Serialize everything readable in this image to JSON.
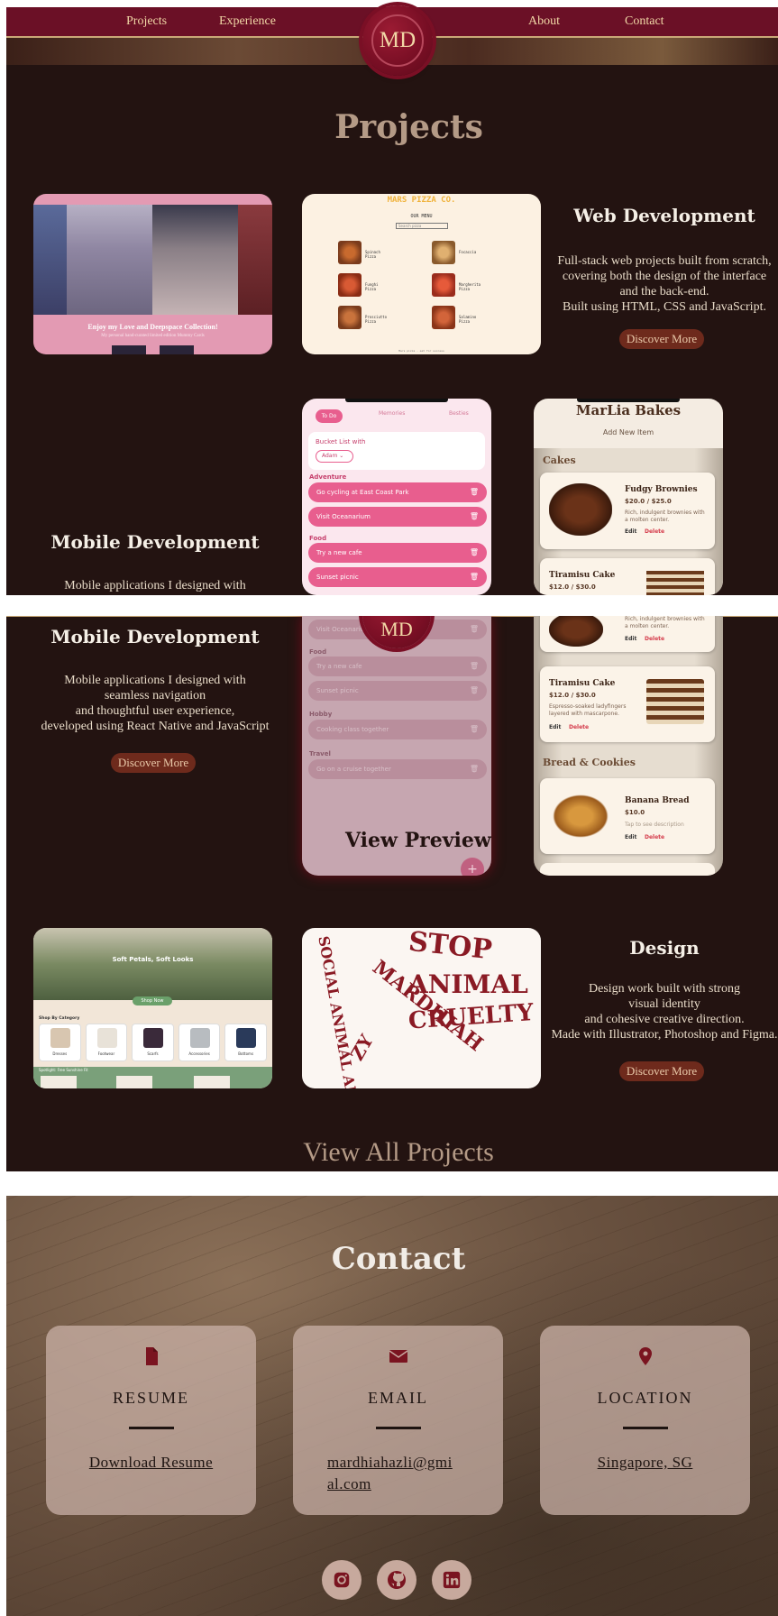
{
  "nav": {
    "projects": "Projects",
    "experience": "Experience",
    "about": "About",
    "contact": "Contact",
    "logo": "MD"
  },
  "projects": {
    "title": "Projects",
    "web": {
      "heading": "Web Development",
      "description": "Full-stack web projects built from scratch,\ncovering both the design of the interface\nand the back-end.\nBuilt using HTML, CSS and JavaScript.",
      "button": "Discover More",
      "shot1": {
        "title": "Enjoy my Love and Deepspace Collection!",
        "subtitle": "My personal hand-curated limited edition Mummy Cards"
      },
      "shot2": {
        "title": "MARS PIZZA CO.",
        "menu": "OUR MENU",
        "search": "Search pizza",
        "footer": "Mars pizza - eat for success",
        "items": [
          "Spinach Pizza",
          "Focaccia",
          "Funghi Pizza",
          "Margherita Pizza",
          "Prosciutto Pizza",
          "Salamino Pizza"
        ]
      }
    },
    "mobile": {
      "heading": "Mobile Development",
      "description_short": "Mobile applications I designed with\nseamless navigation",
      "description": "Mobile applications I designed with\nseamless navigation\nand thoughtful user experience,\ndeveloped using React Native and JavaScript",
      "button": "Discover More",
      "todo": {
        "tabs": [
          "To Do",
          "Memories",
          "Besties"
        ],
        "bucket": "Bucket List with",
        "select": "Adam",
        "sections": [
          "Adventure",
          "Food",
          "Hobby",
          "Travel"
        ],
        "items": [
          "Go cycling at East Coast Park",
          "Visit Oceanarium",
          "Try a new cafe",
          "Sunset picnic",
          "Cooking class together",
          "Go on a cruise together"
        ],
        "overlay": "View Preview",
        "fab": "+"
      },
      "bakes": {
        "title": "MarLia Bakes",
        "add": "Add New Item",
        "cat1": "Cakes",
        "cat2": "Bread & Cookies",
        "items": [
          {
            "name": "Fudgy Brownies",
            "price": "$20.0 / $25.0",
            "desc": "Rich, indulgent brownies with a molten center."
          },
          {
            "name": "Tiramisu Cake",
            "price": "$12.0 / $30.0",
            "desc": "Espresso-soaked ladyfingers layered with mascarpone."
          },
          {
            "name": "Banana Bread",
            "price": "$10.0",
            "desc": "Tap to see description"
          }
        ],
        "edit": "Edit",
        "delete": "Delete"
      }
    },
    "design": {
      "heading": "Design",
      "description": "Design work built with strong\nvisual identity\nand cohesive creative direction.\nMade with Illustrator, Photoshop and Figma.",
      "button": "Discover More",
      "shot1": {
        "title": "Soft Petals, Soft Looks",
        "shop": "Shop Now",
        "category": "Shop By Category",
        "cats": [
          "Dresses",
          "Footwear",
          "Scarfs",
          "Accessories",
          "Bottoms"
        ],
        "spot": "Spotlight: Free Sunshine Fit"
      },
      "shot2": {
        "words": [
          "STOP",
          "ANIMAL",
          "CRUELTY",
          "MARDHIAH",
          "ZY",
          "SOCIAL ANIMAL ADVOCACY"
        ]
      }
    },
    "view_all": "View All Projects"
  },
  "contact": {
    "title": "Contact",
    "cards": [
      {
        "label": "RESUME",
        "value": "Download Resume",
        "icon": "file-icon"
      },
      {
        "label": "EMAIL",
        "value": "mardhiahazli@gmi\nal.com",
        "icon": "envelope-icon"
      },
      {
        "label": "LOCATION",
        "value": "Singapore, SG",
        "icon": "map-pin-icon"
      }
    ],
    "social": [
      "instagram-icon",
      "github-icon",
      "linkedin-icon"
    ]
  },
  "colors": {
    "nav": "#6b1026",
    "gold": "#f1d7a6",
    "panel": "#231311",
    "button": "#6e2a1c",
    "pink": "#e85e8e"
  }
}
